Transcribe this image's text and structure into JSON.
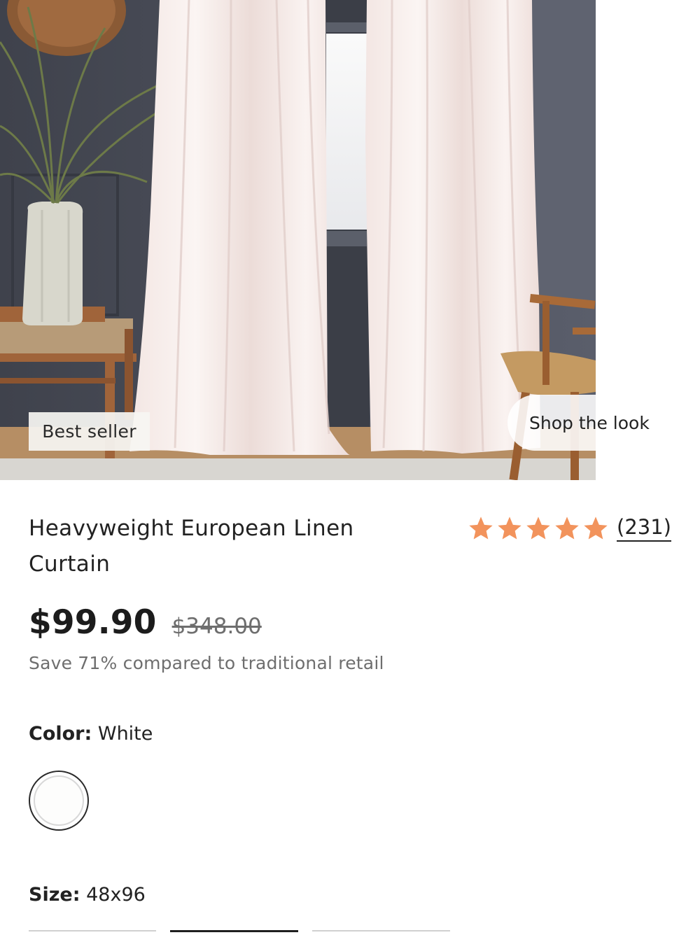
{
  "hero": {
    "badge": "Best seller",
    "shop_the_look": "Shop the look"
  },
  "product": {
    "title": "Heavyweight European Linen Curtain",
    "rating": 5,
    "review_count": "(231)",
    "price": "$99.90",
    "compare_price": "$348.00",
    "savings_text": "Save 71% compared to traditional retail"
  },
  "options": {
    "color_label": "Color:",
    "color_value": "White",
    "swatch_color": "#fdfdfc",
    "size_label": "Size:",
    "size_value": "48x96"
  },
  "colors": {
    "star": "#f2935c",
    "text": "#222222",
    "muted": "#6e6e6e"
  },
  "icons": {
    "star": "star-icon"
  }
}
